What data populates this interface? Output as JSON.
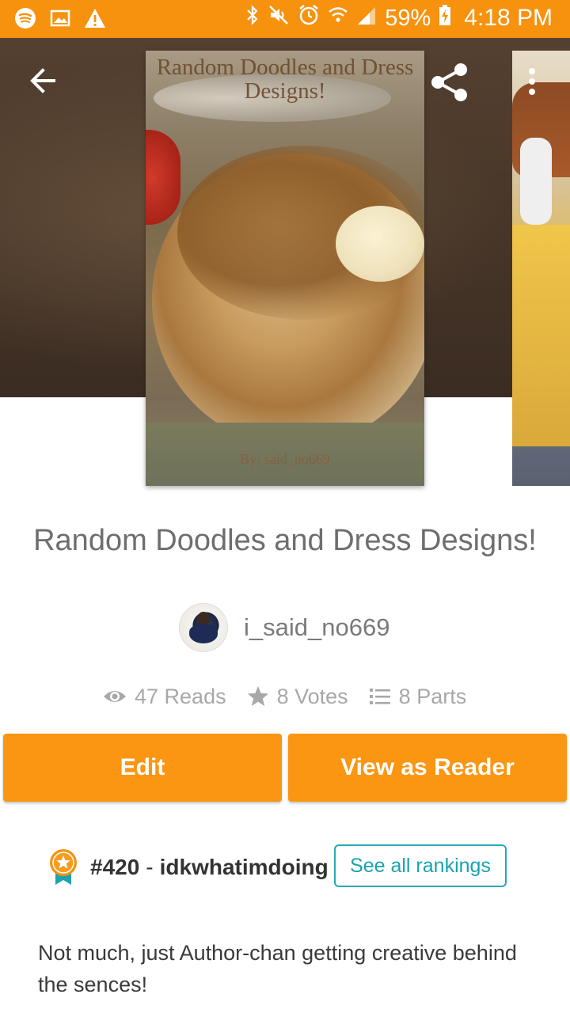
{
  "status_bar": {
    "battery_percent": "59%",
    "time": "4:18 PM",
    "background_color": "#f7920f",
    "left_icons": [
      "spotify-icon",
      "image-icon",
      "warning-icon"
    ],
    "right_icons": [
      "bluetooth-icon",
      "mute-icon",
      "alarm-icon",
      "wifi-icon",
      "signal-icon",
      "battery-charging-icon"
    ]
  },
  "hero": {
    "cover_title": "Random Doodles and Dress Designs!",
    "cover_byline": "By: said_no669"
  },
  "story": {
    "title": "Random Doodles and Dress Designs!",
    "author": "i_said_no669",
    "stats": {
      "reads": "47 Reads",
      "votes": "8 Votes",
      "parts": "8 Parts"
    }
  },
  "actions": {
    "edit_label": "Edit",
    "view_as_reader_label": "View as Reader",
    "accent_color": "#fb9612"
  },
  "ranking": {
    "rank": "#420",
    "separator": "-",
    "tag": "idkwhatimdoing",
    "see_all_label": "See all rankings",
    "link_color": "#1aa3b0"
  },
  "description": "Not much, just Author-chan getting creative behind the sences!"
}
